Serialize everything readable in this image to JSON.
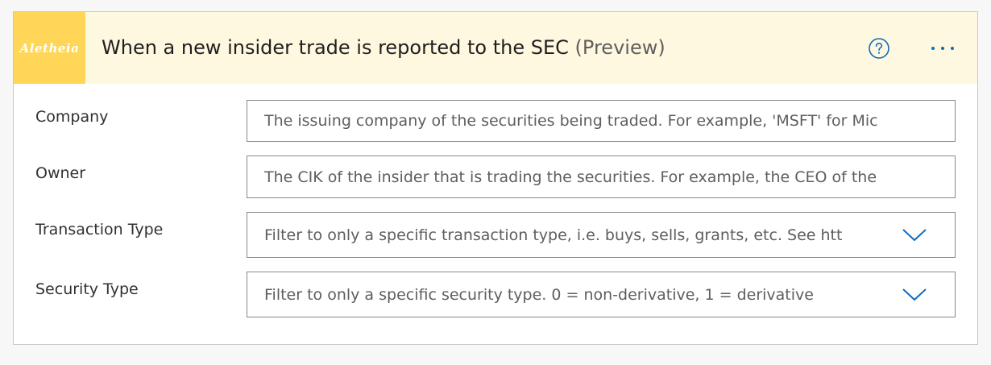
{
  "header": {
    "logo_text": "Aletheia",
    "title": "When a new insider trade is reported to the SEC",
    "title_suffix": "(Preview)",
    "help_icon": "help-circle-icon",
    "more_icon": "more-horizontal-icon"
  },
  "colors": {
    "header_bg": "#fef8e0",
    "logo_bg": "#ffd657",
    "accent": "#0f6cbd",
    "border": "#8a8886"
  },
  "fields": [
    {
      "label": "Company",
      "placeholder": "The issuing company of the securities being traded. For example, 'MSFT' for Mic",
      "type": "text"
    },
    {
      "label": "Owner",
      "placeholder": "The CIK of the insider that is trading the securities. For example, the CEO of the",
      "type": "text"
    },
    {
      "label": "Transaction Type",
      "placeholder": "Filter to only a specific transaction type, i.e. buys, sells, grants, etc. See htt",
      "type": "dropdown",
      "icon": "chevron-down-icon"
    },
    {
      "label": "Security Type",
      "placeholder": "Filter to only a specific security type. 0 = non-derivative, 1 = derivative",
      "type": "dropdown",
      "icon": "chevron-down-icon"
    }
  ]
}
